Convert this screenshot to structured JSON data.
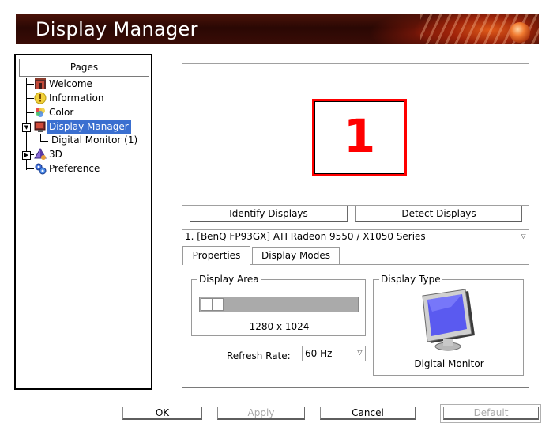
{
  "window": {
    "title": "Display Manager"
  },
  "sidebar": {
    "header": "Pages",
    "items": [
      {
        "label": "Welcome",
        "icon": "welcome-icon"
      },
      {
        "label": "Information",
        "icon": "information-icon"
      },
      {
        "label": "Color",
        "icon": "color-icon"
      },
      {
        "label": "Display Manager",
        "icon": "display-manager-icon",
        "selected": true,
        "expanded": true
      },
      {
        "label": "Digital Monitor (1)",
        "icon": ""
      },
      {
        "label": "3D",
        "icon": "3d-icon",
        "expanded": false
      },
      {
        "label": "Preference",
        "icon": "preference-icon"
      }
    ]
  },
  "preview": {
    "monitor_number": "1",
    "highlight_color": "#ff0000"
  },
  "actions": {
    "identify": "Identify Displays",
    "detect": "Detect Displays"
  },
  "adapter_select": {
    "value": "1.  [BenQ FP93GX] ATI Radeon 9550 / X1050 Series"
  },
  "tabs": [
    {
      "label": "Properties",
      "active": true
    },
    {
      "label": "Display Modes",
      "active": false
    }
  ],
  "properties": {
    "display_area": {
      "title": "Display Area",
      "resolution": "1280 x 1024"
    },
    "refresh_rate": {
      "label": "Refresh Rate:",
      "value": "60 Hz"
    },
    "display_type": {
      "title": "Display Type",
      "value": "Digital Monitor"
    }
  },
  "buttons": {
    "ok": "OK",
    "apply": "Apply",
    "cancel": "Cancel",
    "default": "Default"
  },
  "colors": {
    "selection": "#3a6fd0",
    "accent_red": "#ff0000"
  }
}
